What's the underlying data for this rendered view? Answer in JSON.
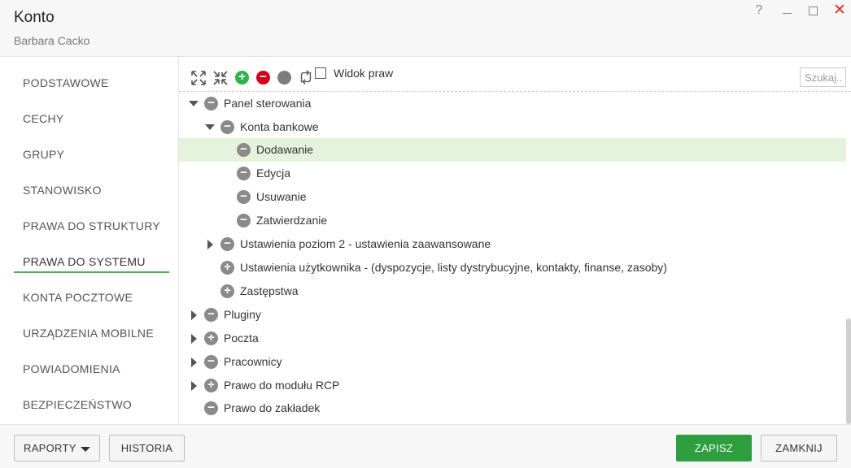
{
  "window": {
    "title": "Konto",
    "subtitle": "Barbara Cacko",
    "help": "?",
    "close": "✕"
  },
  "sidebar": {
    "items": [
      {
        "label": "PODSTAWOWE"
      },
      {
        "label": "CECHY"
      },
      {
        "label": "GRUPY"
      },
      {
        "label": "STANOWISKO"
      },
      {
        "label": "PRAWA DO STRUKTURY"
      },
      {
        "label": "PRAWA DO SYSTEMU",
        "active": true
      },
      {
        "label": "KONTA POCZTOWE"
      },
      {
        "label": "URZĄDZENIA MOBILNE"
      },
      {
        "label": "POWIADOMIENIA"
      },
      {
        "label": "BEZPIECZEŃSTWO"
      }
    ],
    "accent_color": "#4caf50"
  },
  "toolbar": {
    "expand_all_icon": "expand-arrows-icon",
    "collapse_all_icon": "collapse-arrows-icon",
    "add_icon": "+",
    "remove_icon": "−",
    "neutral_icon": "",
    "refresh_icon": "refresh-icon",
    "view_rights_label": "Widok praw",
    "view_rights_checked": false,
    "search_placeholder": "Szukaj..",
    "colors": {
      "add": "#2db34a",
      "remove": "#d0021b",
      "neutral": "#7d7d7d"
    }
  },
  "tree": {
    "rows": [
      {
        "label": "Panel sterowania",
        "caret": "down",
        "icon": "−",
        "selected": false
      },
      {
        "label": "Konta bankowe",
        "caret": "down",
        "icon": "−",
        "selected": false
      },
      {
        "label": "Dodawanie",
        "caret": "",
        "icon": "−",
        "selected": true
      },
      {
        "label": "Edycja",
        "caret": "",
        "icon": "−",
        "selected": false
      },
      {
        "label": "Usuwanie",
        "caret": "",
        "icon": "−",
        "selected": false
      },
      {
        "label": "Zatwierdzanie",
        "caret": "",
        "icon": "−",
        "selected": false
      },
      {
        "label": "Ustawienia poziom 2 - ustawienia zaawansowane",
        "caret": "right",
        "icon": "−",
        "selected": false
      },
      {
        "label": "Ustawienia użytkownika - (dyspozycje, listy dystrybucyjne, kontakty, finanse, zasoby)",
        "caret": "",
        "icon": "+",
        "selected": false
      },
      {
        "label": "Zastępstwa",
        "caret": "",
        "icon": "+",
        "selected": false
      },
      {
        "label": "Pluginy",
        "caret": "right",
        "icon": "−",
        "selected": false
      },
      {
        "label": "Poczta",
        "caret": "right",
        "icon": "+",
        "selected": false
      },
      {
        "label": "Pracownicy",
        "caret": "right",
        "icon": "−",
        "selected": false
      },
      {
        "label": "Prawo do modułu RCP",
        "caret": "right",
        "icon": "+",
        "selected": false
      },
      {
        "label": "Prawo do zakładek",
        "caret": "",
        "icon": "−",
        "selected": false
      }
    ],
    "selected_color": "#e6f3dc"
  },
  "footer": {
    "reports_label": "RAPORTY",
    "history_label": "HISTORIA",
    "save_label": "ZAPISZ",
    "close_label": "ZAMKNIJ",
    "save_color": "#2e9e3e"
  }
}
